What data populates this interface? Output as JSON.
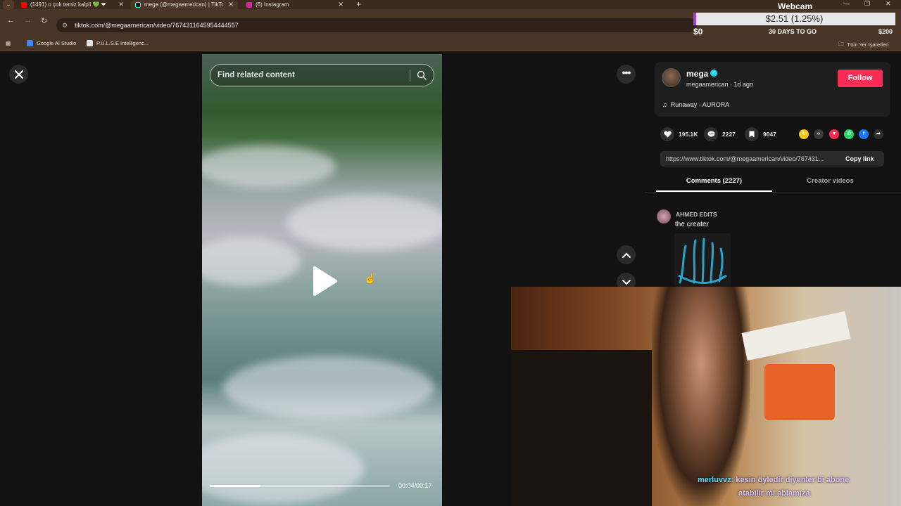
{
  "browser": {
    "tabs": [
      {
        "title": "(1491) o çok temiz kalpli 💚 ❤",
        "color": "#ff0000"
      },
      {
        "title": "mega (@megaamerican) | TikTok",
        "color": "#111111"
      },
      {
        "title": "(6) Instagram",
        "color": "#d6249f"
      }
    ],
    "url": "tiktok.com/@megaamerican/video/7674311645954444557",
    "bookmarks": [
      "Google AI Studio",
      "P.U.L.S.E Intelligenc...",
      "Tüm Yer İşaretleri"
    ]
  },
  "overlay": {
    "title": "Webcam",
    "amount": "$2.51 (1.25%)",
    "start": "$0",
    "days_left": "30 DAYS TO GO",
    "goal": "$200",
    "progress": 0.0125
  },
  "video": {
    "search_placeholder": "Find related content",
    "time": "00:04/00:17",
    "progress": 0.28
  },
  "author": {
    "name": "mega",
    "meta": "megaamerican · 1d ago",
    "follow_label": "Follow",
    "music": "Runaway - AURORA"
  },
  "stats": {
    "likes": "195.1K",
    "comments": "2227",
    "saves": "9047"
  },
  "share_colors": [
    "#f5c518",
    "#3a3a3a",
    "#fe2c55",
    "#25d366",
    "#1877f2",
    "#2f2f2f"
  ],
  "link": {
    "url": "https://www.tiktok.com/@megaamerican/video/767431...",
    "copy_label": "Copy link"
  },
  "tabs": {
    "comments": "Comments (2227)",
    "creator": "Creator videos"
  },
  "comment": {
    "user": "AHMED EDITS",
    "text": "the creater"
  },
  "chat": {
    "user": "merluvvz:",
    "line1": "kesin öyledir diyenler bi abone",
    "line2": "atabilir mi ablamıza"
  }
}
